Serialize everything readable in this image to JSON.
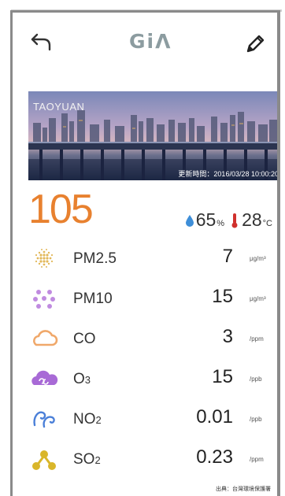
{
  "header": {
    "logo": "GiΛ",
    "back_icon": "back-arrow-icon",
    "edit_icon": "pencil-icon"
  },
  "banner": {
    "city": "TAOYUAN",
    "timestamp": "更新時間：2016/03/28 10:00:20"
  },
  "aqi": {
    "value": "105",
    "color": "#e8812f"
  },
  "weather": {
    "humidity": "65",
    "humidity_unit": "%",
    "temperature": "28",
    "temperature_unit": "°C"
  },
  "pollutants": [
    {
      "name": "PM2.5",
      "name_main": "PM2.5",
      "name_sub": "",
      "value": "7",
      "unit": "μg/m³",
      "icon": "pm25-dots-icon",
      "color": "#e2b85a"
    },
    {
      "name": "PM10",
      "name_main": "PM10",
      "name_sub": "",
      "value": "15",
      "unit": "μg/m³",
      "icon": "pm10-dots-icon",
      "color": "#c08be0"
    },
    {
      "name": "CO",
      "name_main": "CO",
      "name_sub": "",
      "value": "3",
      "unit": "/ppm",
      "icon": "cloud-icon",
      "color": "#f0a86a"
    },
    {
      "name": "O3",
      "name_main": "O",
      "name_sub": "3",
      "value": "15",
      "unit": "/ppb",
      "icon": "swirl-cloud-icon",
      "color": "#a86ad6"
    },
    {
      "name": "NO2",
      "name_main": "NO",
      "name_sub": "2",
      "value": "0.01",
      "unit": "/ppb",
      "icon": "wind-swirl-icon",
      "color": "#4a7fd8"
    },
    {
      "name": "SO2",
      "name_main": "SO",
      "name_sub": "2",
      "value": "0.23",
      "unit": "/ppm",
      "icon": "molecule-icon",
      "color": "#d9b62a"
    }
  ],
  "source": "出典：台灣環境保護署"
}
